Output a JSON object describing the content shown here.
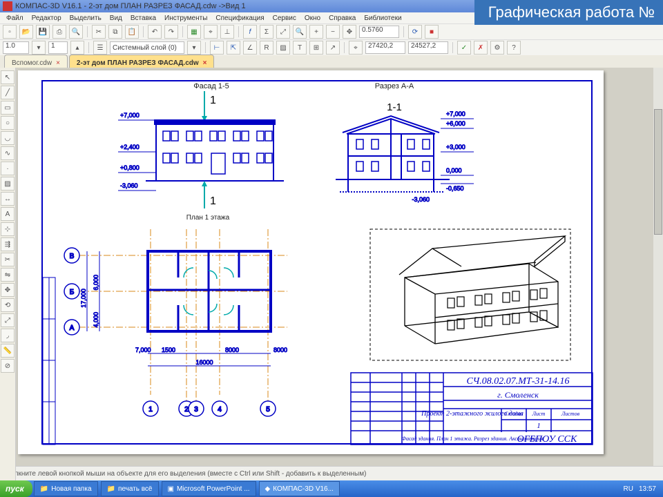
{
  "title": "КОМПАС-3D V16.1 - 2-эт дом ПЛАН РАЗРЕЗ ФАСАД.cdw ->Вид 1",
  "watermark": "Графическая работа №",
  "menu": [
    "Файл",
    "Редактор",
    "Выделить",
    "Вид",
    "Вставка",
    "Инструменты",
    "Спецификация",
    "Сервис",
    "Окно",
    "Справка",
    "Библиотеки"
  ],
  "toolbar2": {
    "coord1": "27420,2",
    "coord2": "24527,2",
    "zoom": "0.5760",
    "layer": "Системный слой (0)"
  },
  "toolbar3": {
    "scale": "1.0",
    "spin": "1"
  },
  "tabs": [
    {
      "label": "Вспомог.cdw",
      "active": false
    },
    {
      "label": "2-эт дом ПЛАН РАЗРЕЗ ФАСАД.cdw",
      "active": true
    }
  ],
  "status": "Щелкните левой кнопкой мыши на объекте для его выделения (вместе с Ctrl или Shift - добавить к выделенным)",
  "drawing": {
    "facade_title": "Фасад 1-5",
    "section_title": "Разрез А-А",
    "plan_title": "План 1 этажа",
    "marks": {
      "one": "1",
      "one_one": "1-1",
      "lev_top": "+7,000",
      "lev_6": "+6,000",
      "lev_3": "+3,000",
      "lev_0": "0,000",
      "lev_m065": "-0,650",
      "lev_m306": "-3,060",
      "lev_f_top": "+7,000",
      "lev_f24": "+2,400",
      "lev_f08": "+0,800"
    },
    "plan_axes": {
      "A": "А",
      "B": "Б",
      "V": "В",
      "1": "1",
      "2": "2",
      "3": "3",
      "4": "4",
      "5": "5"
    },
    "plan_dims": {
      "d7000": "7,000",
      "d6000": "6,000",
      "d4000": "4,000",
      "d17000": "17,000",
      "d1500": "1500",
      "d8000": "8000",
      "d16000": "16000"
    },
    "titleblock": {
      "code": "СЧ.08.02.07.МТ-31-14.16",
      "city": "г. Смоленск",
      "project": "Проект 2-этажного жилого дома",
      "sheets": "Фасад здания. План 1 этажа. Разрез здания. Аксонометрия",
      "org": "ОГБПОУ ССК",
      "stage": "Стадия",
      "sheet": "Лист",
      "sheets_h": "Листов",
      "one": "1"
    }
  },
  "taskbar": {
    "start": "пуск",
    "items": [
      "Новая папка",
      "печать всё",
      "Microsoft PowerPoint ...",
      "КОМПАС-3D V16..."
    ],
    "lang": "RU",
    "clock": "13:57"
  }
}
